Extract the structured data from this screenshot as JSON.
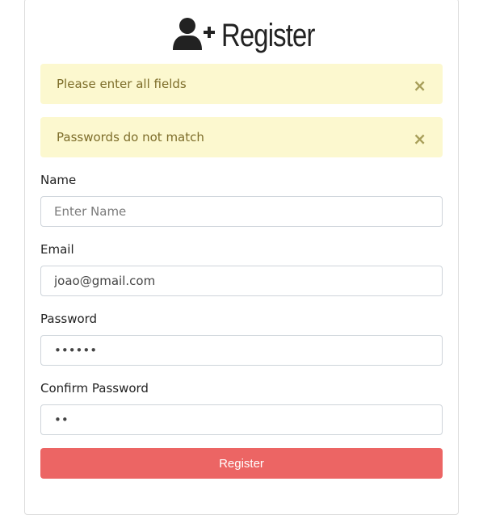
{
  "header": {
    "title": "Register",
    "icon": "user-plus-icon"
  },
  "alerts": [
    {
      "message": "Please enter all fields",
      "close_label": "×"
    },
    {
      "message": "Passwords do not match",
      "close_label": "×"
    }
  ],
  "form": {
    "name": {
      "label": "Name",
      "placeholder": "Enter Name",
      "value": ""
    },
    "email": {
      "label": "Email",
      "placeholder": "",
      "value": "joao@gmail.com"
    },
    "password": {
      "label": "Password",
      "value": "123456"
    },
    "confirm_password": {
      "label": "Confirm Password",
      "value": "12"
    },
    "submit_label": "Register"
  },
  "colors": {
    "alert_bg": "#fcf8cf",
    "alert_text": "#7d6d2a",
    "button_bg": "#ec6564"
  }
}
